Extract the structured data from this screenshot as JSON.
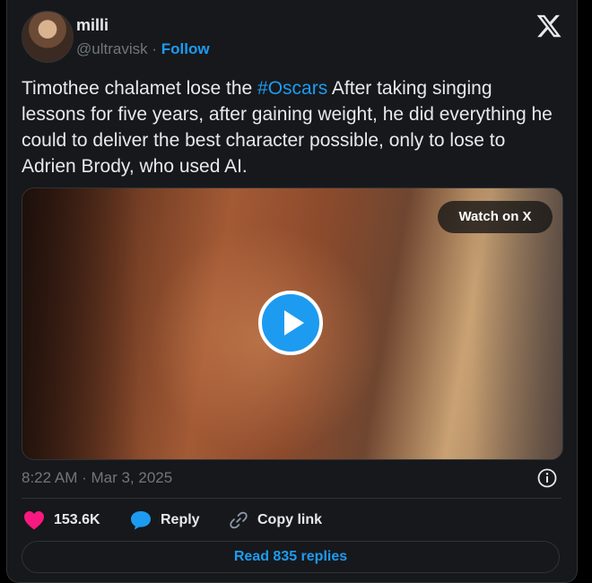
{
  "author": {
    "name": "milli",
    "handle": "@ultravisk",
    "separator": "·",
    "follow_label": "Follow"
  },
  "tweet": {
    "text_before": "Timothee chalamet lose the ",
    "hashtag": "#Oscars",
    "text_after": " After taking singing lessons for five years, after gaining weight, he did everything he could to deliver the best character possible, only to lose to Adrien Brody, who used AI.",
    "timestamp": "8:22 AM · Mar 3, 2025"
  },
  "media": {
    "watch_label": "Watch on X",
    "play_icon": "play-icon"
  },
  "actions": {
    "likes_count": "153.6K",
    "reply_label": "Reply",
    "copy_link_label": "Copy link",
    "read_replies_label": "Read 835 replies"
  },
  "colors": {
    "accent": "#1d9bf0",
    "like": "#f91880",
    "background": "#16181c",
    "muted": "#71767b"
  }
}
